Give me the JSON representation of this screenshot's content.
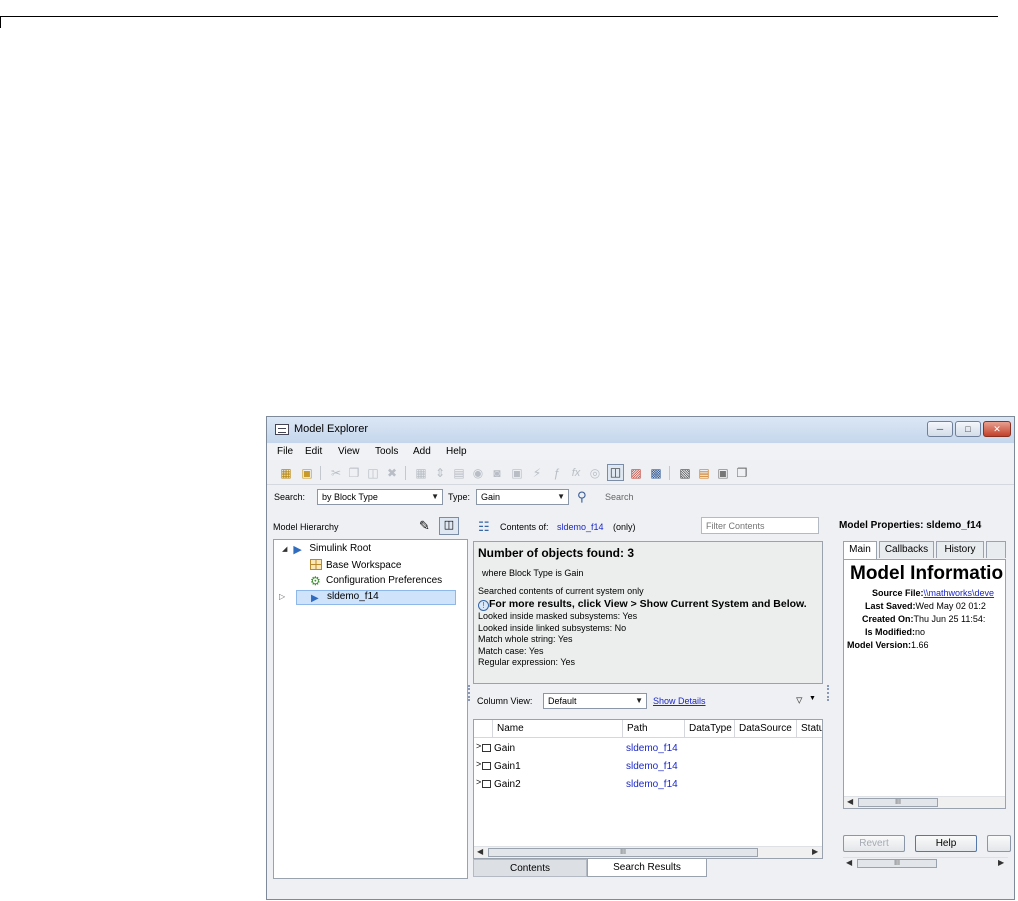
{
  "window": {
    "title": "Model Explorer"
  },
  "menu": [
    "File",
    "Edit",
    "View",
    "Tools",
    "Add",
    "Help"
  ],
  "search": {
    "label": "Search:",
    "by_value": "by Block Type",
    "type_label": "Type:",
    "type_value": "Gain",
    "search_button": "Search"
  },
  "hierarchy": {
    "title": "Model Hierarchy",
    "items": [
      {
        "label": "Simulink Root"
      },
      {
        "label": "Base Workspace"
      },
      {
        "label": "Configuration Preferences"
      },
      {
        "label": "sldemo_f14"
      }
    ]
  },
  "contents": {
    "label": "Contents of:",
    "model": "sldemo_f14",
    "scope": "(only)",
    "filter_placeholder": "Filter Contents"
  },
  "results": {
    "found": "Number of objects found: 3",
    "where": "where Block Type is Gain",
    "searched": "Searched contents of current system only",
    "hint": "For more results, click View > Show Current System and Below.",
    "masked": "Looked inside masked subsystems: Yes",
    "linked": "Looked inside linked subsystems: No",
    "whole": "Match whole string: Yes",
    "case": "Match case: Yes",
    "regex": "Regular expression: Yes"
  },
  "column_view": {
    "label": "Column View:",
    "value": "Default",
    "show_details": "Show Details"
  },
  "table": {
    "columns": [
      "Name",
      "Path",
      "DataType",
      "DataSource",
      "Statu"
    ],
    "rows": [
      {
        "name": "Gain",
        "path": "sldemo_f14"
      },
      {
        "name": "Gain1",
        "path": "sldemo_f14"
      },
      {
        "name": "Gain2",
        "path": "sldemo_f14"
      }
    ]
  },
  "bottom_tabs": {
    "contents": "Contents",
    "search_results": "Search Results"
  },
  "properties": {
    "title": "Model Properties: sldemo_f14",
    "tabs": [
      "Main",
      "Callbacks",
      "History"
    ],
    "heading": "Model Informatio",
    "source_file_label": "Source File:",
    "source_file_value": "\\\\mathworks\\deve",
    "last_saved_label": "Last Saved:",
    "last_saved_value": "Wed May 02 01:2",
    "created_on_label": "Created On:",
    "created_on_value": "Thu Jun 25 11:54:",
    "is_modified_label": "Is Modified:",
    "is_modified_value": "no",
    "model_version_label": "Model Version:",
    "model_version_value": "1.66",
    "revert": "Revert",
    "help": "Help"
  },
  "scroll_thumb": "III",
  "colors": {
    "link": "#1b27c8",
    "selection": "#cfe3fb"
  }
}
